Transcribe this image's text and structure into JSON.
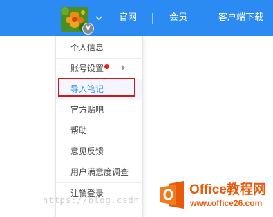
{
  "header": {
    "avatar_badge": "V",
    "nav": [
      "官网",
      "会员",
      "客户端下载"
    ]
  },
  "menu": {
    "items": [
      {
        "label": "个人信息",
        "active": false,
        "has_dot": false,
        "has_submenu": false
      },
      {
        "label": "账号设置",
        "active": false,
        "has_dot": true,
        "has_submenu": true
      },
      {
        "label": "导入笔记",
        "active": true,
        "has_dot": false,
        "has_submenu": false,
        "highlighted": true
      },
      {
        "label": "官方贴吧",
        "active": false,
        "has_dot": false,
        "has_submenu": false
      },
      {
        "label": "帮助",
        "active": false,
        "has_dot": false,
        "has_submenu": false
      },
      {
        "label": "意见反馈",
        "active": false,
        "has_dot": false,
        "has_submenu": false
      },
      {
        "label": "用户满意度调查",
        "active": false,
        "has_dot": false,
        "has_submenu": false
      },
      {
        "label": "注销登录",
        "active": false,
        "has_dot": false,
        "has_submenu": false
      }
    ]
  },
  "watermark": {
    "text": "https://blog.csdn"
  },
  "logo": {
    "title": "Office教程网",
    "url": "www.office26.com"
  },
  "colors": {
    "topbar": "#2b8bf2",
    "highlight_border": "#d01717",
    "notification_dot": "#e8201c",
    "logo_orange": "#e85b0c"
  },
  "icons": {
    "avatar": "flower-avatar",
    "dropdown": "chevron-down-icon",
    "submenu": "caret-right-icon",
    "logo": "office-logo-icon"
  }
}
